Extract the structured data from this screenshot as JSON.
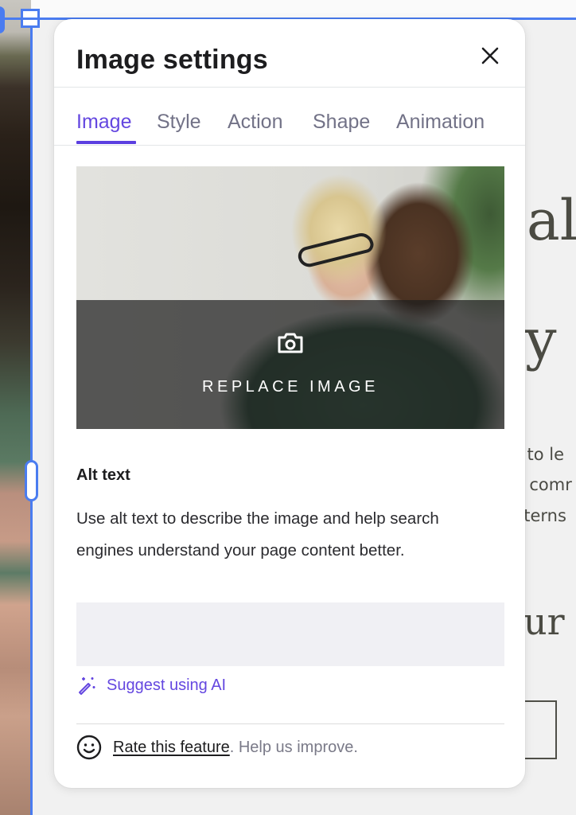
{
  "background_page": {
    "heading_fragments": [
      "al",
      "y",
      "ur"
    ],
    "paragraph_fragments": [
      "ı to le",
      ", comr",
      "tterns"
    ]
  },
  "panel": {
    "title": "Image settings",
    "close_icon": "close-icon",
    "tabs": [
      {
        "label": "Image",
        "active": true
      },
      {
        "label": "Style",
        "active": false
      },
      {
        "label": "Action",
        "active": false
      },
      {
        "label": "Shape",
        "active": false
      },
      {
        "label": "Animation",
        "active": false
      }
    ],
    "image_preview": {
      "replace_label": "REPLACE IMAGE",
      "icon": "camera-icon"
    },
    "alt_text": {
      "title": "Alt text",
      "description": "Use alt text to describe the image and help search engines understand your page content better.",
      "value": "",
      "placeholder": ""
    },
    "ai_suggest": {
      "label": "Suggest using AI",
      "icon": "magic-wand-icon"
    },
    "feedback": {
      "icon": "smiley-icon",
      "link_label": "Rate this feature",
      "trailing_text": ". Help us improve."
    }
  },
  "colors": {
    "accent": "#6447e0",
    "selection": "#4a7cf0",
    "tab_inactive": "#727287",
    "input_bg": "#f0f0f4"
  }
}
